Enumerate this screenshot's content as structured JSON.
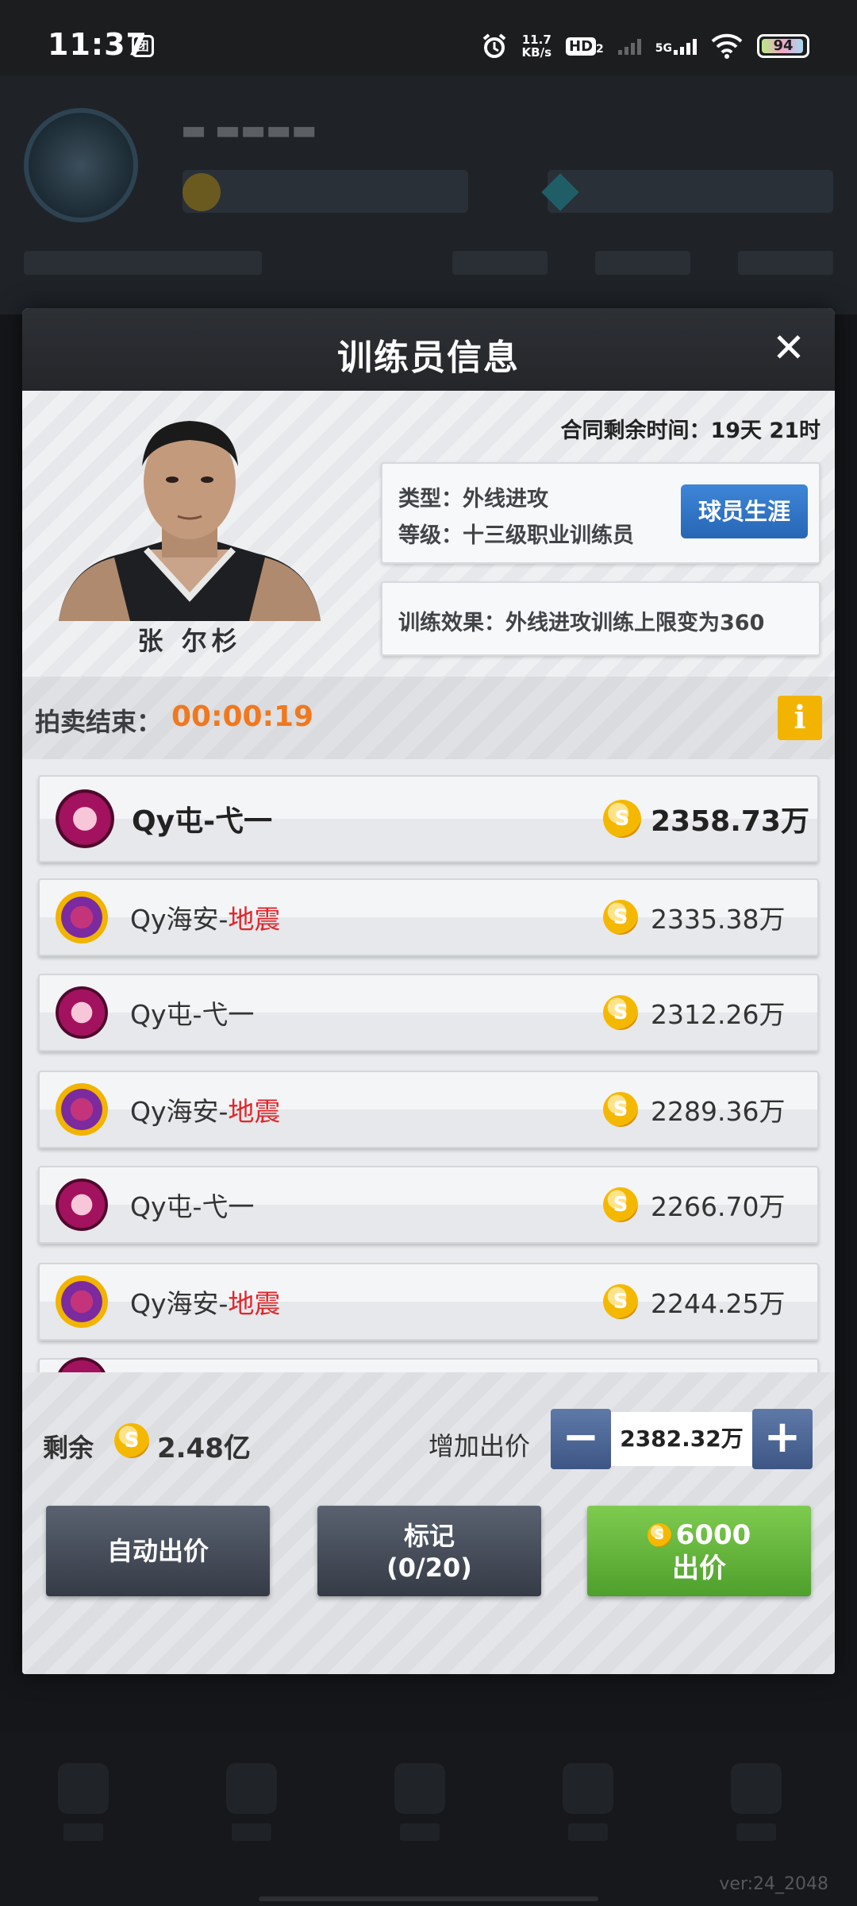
{
  "status_bar": {
    "time": "11:37",
    "app_icon_glyph": "团",
    "net_speed_top": "11.7",
    "net_speed_unit": "KB/s",
    "hd_label": "HD",
    "hd_sub": "2",
    "network": "5G",
    "battery": "94"
  },
  "modal": {
    "title": "训练员信息",
    "close_glyph": "✕",
    "contract_remaining": "合同剩余时间：19天 21时",
    "player_name": "张 尔杉",
    "type_line": "类型：外线进攻",
    "level_line": "等级：十三级职业训练员",
    "career_button": "球员生涯",
    "effect_line": "训练效果：外线进攻训练上限变为360"
  },
  "auction": {
    "end_label": "拍卖结束：",
    "end_time": "00:00:19",
    "info_glyph": "i"
  },
  "bids": [
    {
      "team_prefix": "Qy屯-弋一",
      "team_suffix": "",
      "amount": "2358.73万",
      "logo": "elephant-logo"
    },
    {
      "team_prefix": "Qy海安-",
      "team_suffix": "地震",
      "amount": "2335.38万",
      "logo": "monster-logo"
    },
    {
      "team_prefix": "Qy屯-弋一",
      "team_suffix": "",
      "amount": "2312.26万",
      "logo": "elephant-logo"
    },
    {
      "team_prefix": "Qy海安-",
      "team_suffix": "地震",
      "amount": "2289.36万",
      "logo": "monster-logo"
    },
    {
      "team_prefix": "Qy屯-弋一",
      "team_suffix": "",
      "amount": "2266.70万",
      "logo": "elephant-logo"
    },
    {
      "team_prefix": "Qy海安-",
      "team_suffix": "地震",
      "amount": "2244.25万",
      "logo": "monster-logo"
    }
  ],
  "bottom": {
    "remain_label": "剩余",
    "remain_value": "2.48亿",
    "raise_label": "增加出价",
    "raise_value": "2382.32万",
    "minus_glyph": "−",
    "plus_glyph": "+",
    "auto_bid_label": "自动出价",
    "mark_label": "标记",
    "mark_count": "(0/20)",
    "bid_cost": "6000",
    "bid_label": "出价",
    "coin_glyph": "S"
  },
  "footer": {
    "version": "ver:24_2048"
  },
  "colors": {
    "accent_orange": "#f0781e",
    "career_blue": "#2766b5",
    "bid_green": "#4ea02c",
    "team_red": "#e0262a"
  }
}
